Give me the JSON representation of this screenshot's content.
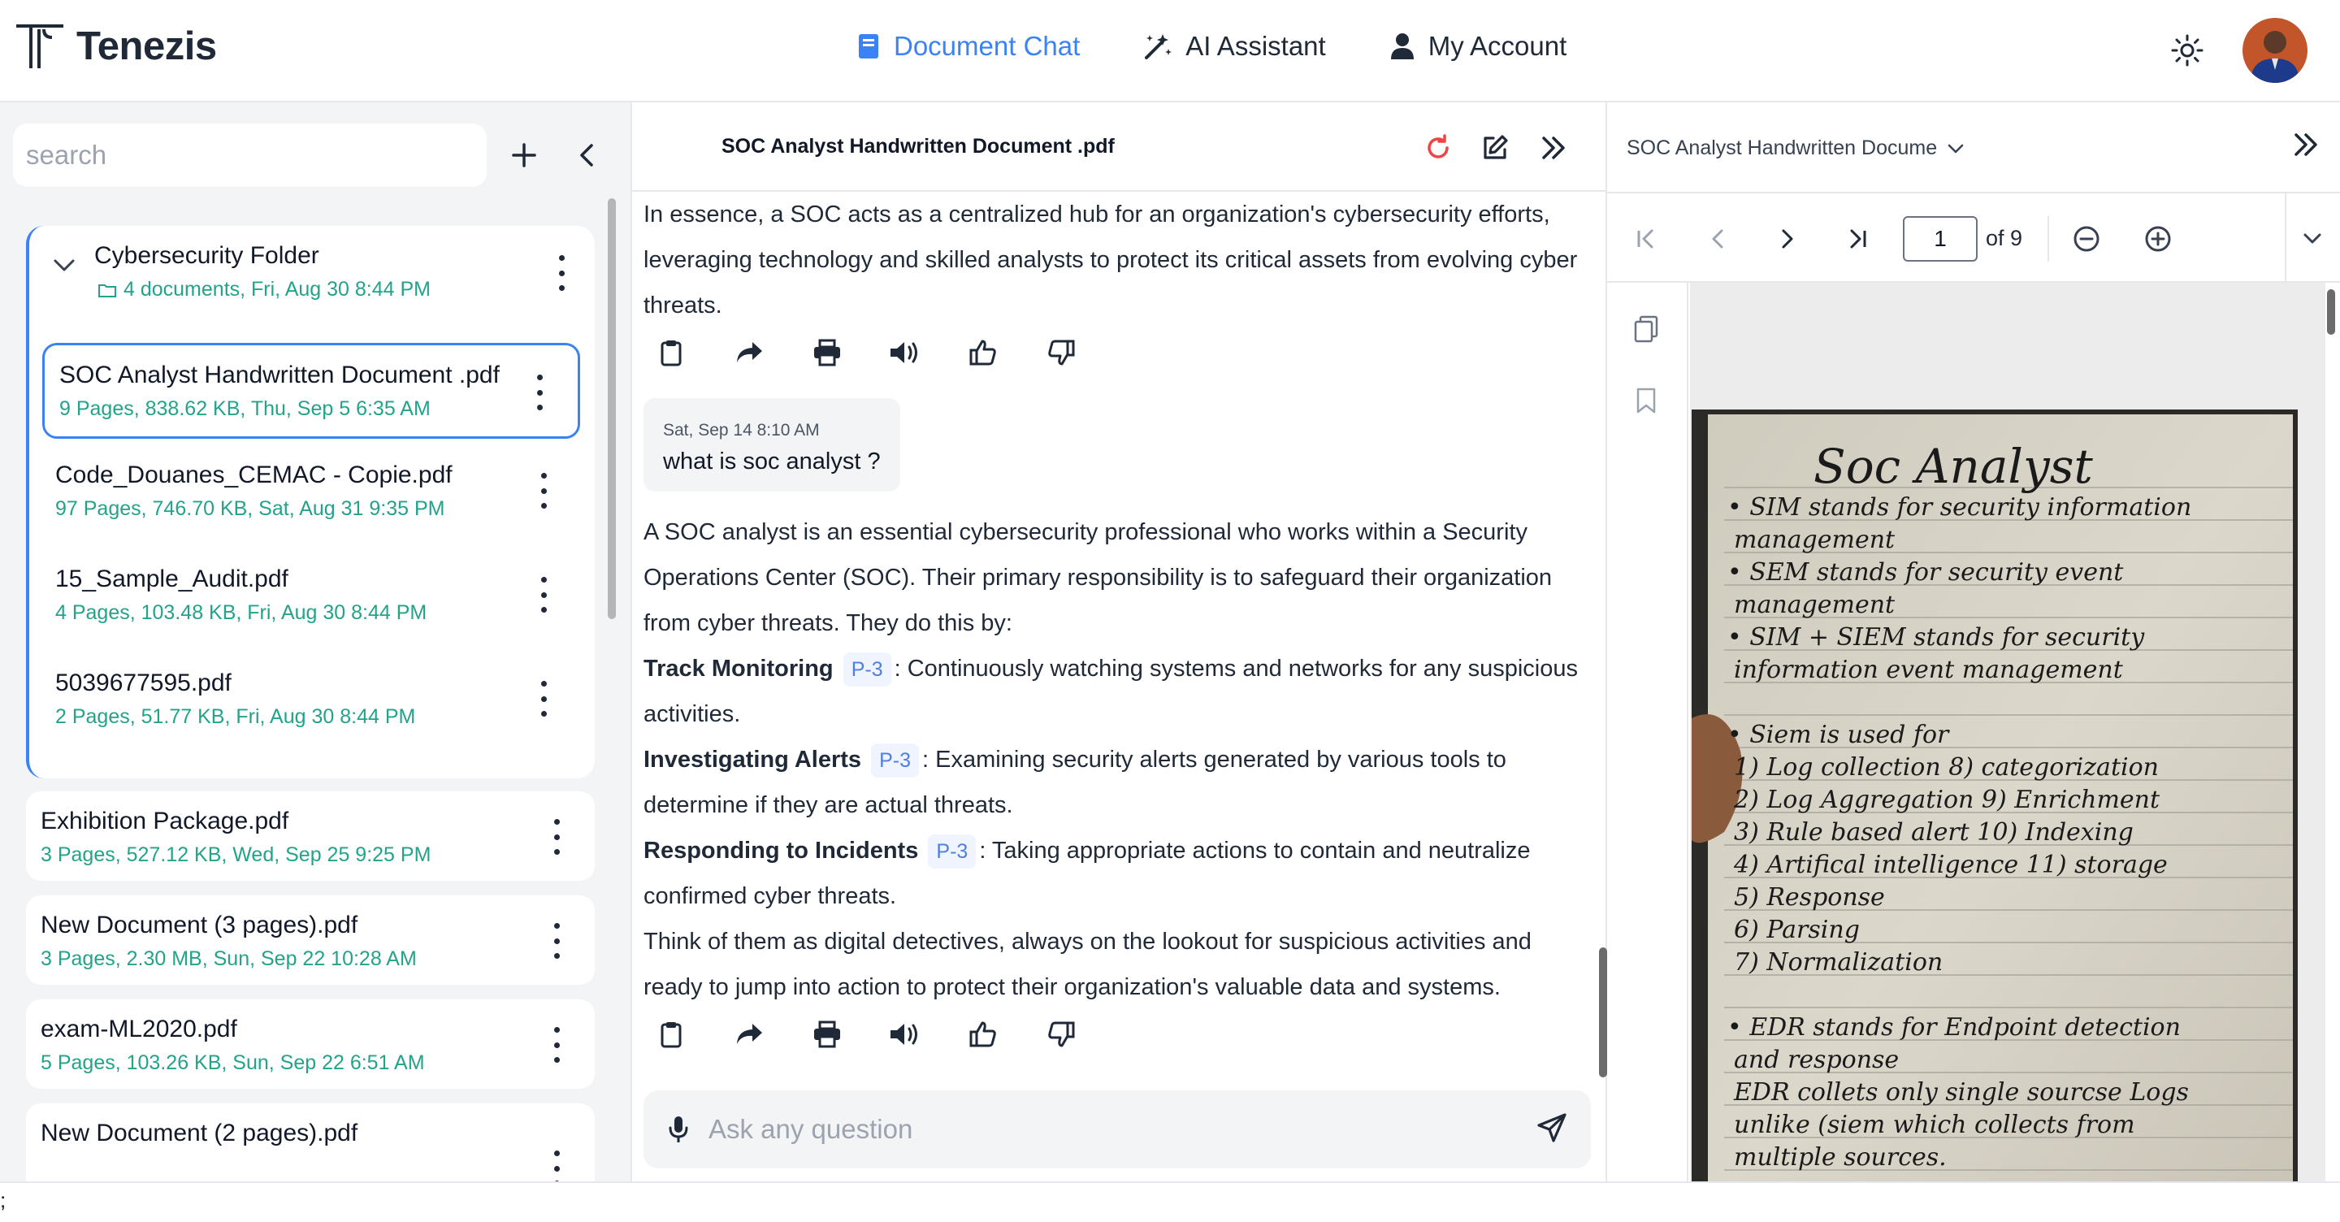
{
  "app": {
    "name": "Tenezis"
  },
  "nav": [
    {
      "label": "Document Chat",
      "icon": "book-icon",
      "active": true
    },
    {
      "label": "AI Assistant",
      "icon": "magic-wand-icon",
      "active": false
    },
    {
      "label": "My Account",
      "icon": "user-icon",
      "active": false
    }
  ],
  "sidebar": {
    "search_placeholder": "search",
    "folder": {
      "title": "Cybersecurity Folder",
      "meta": "4 documents, Fri, Aug 30 8:44 PM"
    },
    "folder_docs": [
      {
        "title": "SOC Analyst Handwritten Document .pdf",
        "meta": "9 Pages, 838.62 KB, Thu, Sep 5 6:35 AM",
        "selected": true
      },
      {
        "title": "Code_Douanes_CEMAC - Copie.pdf",
        "meta": "97 Pages, 746.70 KB, Sat, Aug 31 9:35 PM"
      },
      {
        "title": "15_Sample_Audit.pdf",
        "meta": "4 Pages, 103.48 KB, Fri, Aug 30 8:44 PM"
      },
      {
        "title": "5039677595.pdf",
        "meta": "2 Pages, 51.77 KB, Fri, Aug 30 8:44 PM"
      }
    ],
    "docs": [
      {
        "title": "Exhibition Package.pdf",
        "meta": "3 Pages, 527.12 KB, Wed, Sep 25 9:25 PM"
      },
      {
        "title": "New Document (3 pages).pdf",
        "meta": "3 Pages, 2.30 MB, Sun, Sep 22 10:28 AM"
      },
      {
        "title": "exam-ML2020.pdf",
        "meta": "5 Pages, 103.26 KB, Sun, Sep 22 6:51 AM"
      },
      {
        "title": "New Document (2 pages).pdf",
        "meta": ""
      }
    ]
  },
  "chat": {
    "title": "SOC Analyst Handwritten Document .pdf",
    "intro_text": "In essence, a SOC acts as a centralized hub for an organization's cybersecurity efforts, leveraging technology and skilled analysts to protect its critical assets from evolving cyber threats.",
    "user_message": {
      "time": "Sat, Sep 14 8:10 AM",
      "text": "what is soc analyst ?"
    },
    "answer_intro": "A SOC analyst is an essential cybersecurity professional who works within a Security Operations Center (SOC). Their primary responsibility is to safeguard their organization from cyber threats. They do this by:",
    "points": [
      {
        "term": "Track Monitoring",
        "chip": "P-3",
        "text": ": Continuously watching systems and networks for any suspicious activities."
      },
      {
        "term": "Investigating Alerts",
        "chip": "P-3",
        "text": ": Examining security alerts generated by various tools to determine if they are actual threats."
      },
      {
        "term": "Responding to Incidents",
        "chip": "P-3",
        "text": ": Taking appropriate actions to contain and neutralize confirmed cyber threats."
      }
    ],
    "answer_outro": "Think of them as digital detectives, always on the lookout for suspicious activities and ready to jump into action to protect their organization's valuable data and systems.",
    "ask_placeholder": "Ask any question"
  },
  "viewer": {
    "doc_title": "SOC Analyst Handwritten Docume",
    "page_current": "1",
    "page_total_label": "of 9",
    "notebook": {
      "heading": "Soc Analyst",
      "lines": [
        "• SIM stands for security information",
        "management",
        "• SEM stands for security event",
        "management",
        "• SIM + SIEM stands for security",
        "information event management",
        "",
        "• Siem is used for",
        "1) Log collection        8) categorization",
        "2) Log Aggregation     9) Enrichment",
        "3) Rule based alert     10) Indexing",
        "4) Artifical intelligence  11) storage",
        "5) Response",
        "6) Parsing",
        "7) Normalization",
        "",
        "• EDR stands for Endpoint detection",
        "and response",
        "EDR collets only single sourcse Logs",
        "unlike (siem which collects from",
        "multiple sources."
      ]
    }
  },
  "footer": {
    "glyph": ";"
  }
}
